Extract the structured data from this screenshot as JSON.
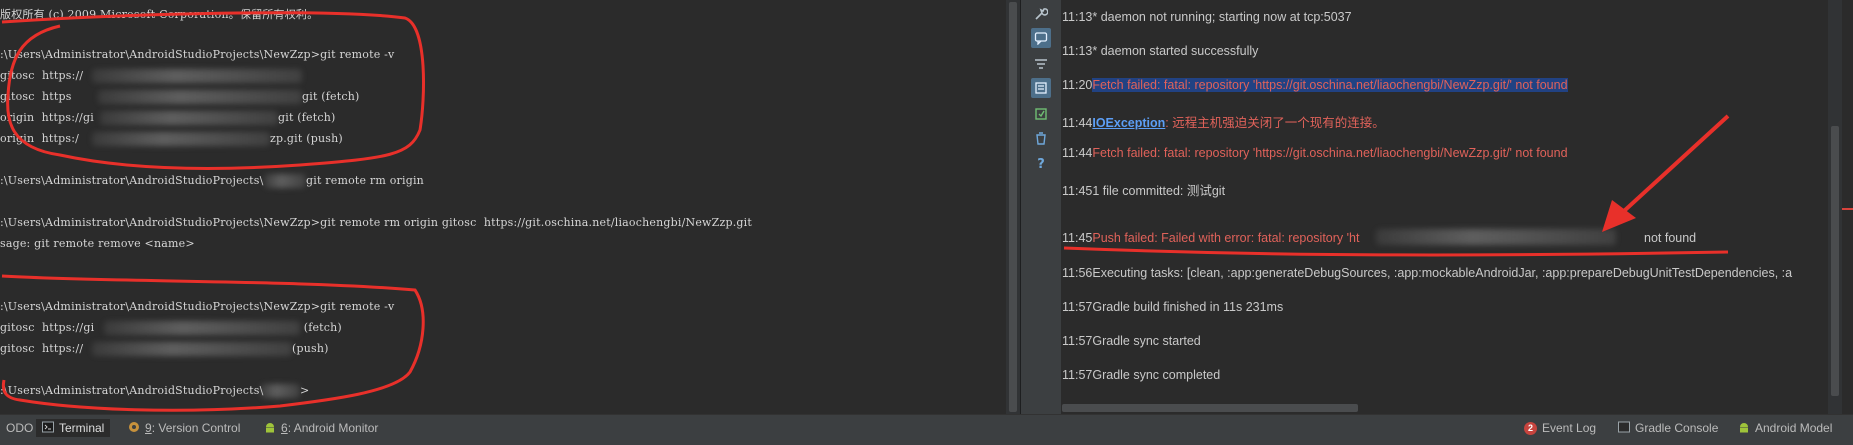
{
  "terminal": {
    "lines": [
      "版权所有 (c) 2009 Microsoft Corporation。保留所有权利。",
      ":\\Users\\Administrator\\AndroidStudioProjects\\NewZzp>git remote -v",
      "gitosc  https://",
      "git (fetch)",
      "gitosc  https",
      "git (push)",
      "origin  https://gi",
      "git (fetch)",
      "origin  https:/",
      "zp.git (push)",
      ":\\Users\\Administrator\\AndroidStudioProjects\\",
      "git remote rm origin",
      ":\\Users\\Administrator\\AndroidStudioProjects\\NewZzp>git remote rm origin gitosc  https://git.oschina.net/liaochengbi/NewZzp.git",
      "sage: git remote remove <name>",
      ":\\Users\\Administrator\\AndroidStudioProjects\\NewZzp>git remote -v",
      "gitosc  https://gi",
      " (fetch)",
      "gitosc  https://",
      "(push)",
      ":\\Users\\Administrator\\AndroidStudioProjects\\",
      ">"
    ]
  },
  "tool_strip": {
    "icons": [
      "wrench-icon",
      "chat-bubble-icon",
      "filter-icon",
      "settings-panel-icon",
      "export-icon",
      "trash-icon",
      "help-icon"
    ]
  },
  "event_log": {
    "events": [
      {
        "time": "11:13",
        "text": "* daemon not running; starting now at tcp:5037"
      },
      {
        "time": "11:13",
        "text": "* daemon started successfully"
      },
      {
        "time": "11:20",
        "text": "Fetch failed: fatal: repository 'https://git.oschina.net/liaochengbi/NewZzp.git/' not found"
      },
      {
        "time": "11:44",
        "link": "IOException",
        "text": ": 远程主机强迫关闭了一个现有的连接。"
      },
      {
        "time": "11:44",
        "text": "Fetch failed: fatal: repository 'https://git.oschina.net/liaochengbi/NewZzp.git/' not found"
      },
      {
        "time": "11:45",
        "text": "1 file committed: 测试git"
      },
      {
        "time": "11:45",
        "text": "Push failed: Failed with error: fatal: repository 'ht",
        "text_tail": "not found"
      },
      {
        "time": "11:56",
        "text": "Executing tasks: [clean, :app:generateDebugSources, :app:mockableAndroidJar, :app:prepareDebugUnitTestDependencies, :a"
      },
      {
        "time": "11:57",
        "text": "Gradle build finished in 11s 231ms"
      },
      {
        "time": "11:57",
        "text": "Gradle sync started"
      },
      {
        "time": "11:57",
        "text": "Gradle sync completed"
      }
    ]
  },
  "bottom_tabs": {
    "todo": "ODO",
    "terminal": "Terminal",
    "vc_num": "9",
    "vc_label": ": Version Control",
    "am_num": "6",
    "am_label": ": Android Monitor",
    "event_badge": "2",
    "event_log": "Event Log",
    "gradle_console": "Gradle Console",
    "android_model": "Android Model"
  },
  "colors": {
    "error": "#e0625a",
    "selection": "#214283",
    "link": "#5c9ef5",
    "annotation": "#e8302a"
  }
}
